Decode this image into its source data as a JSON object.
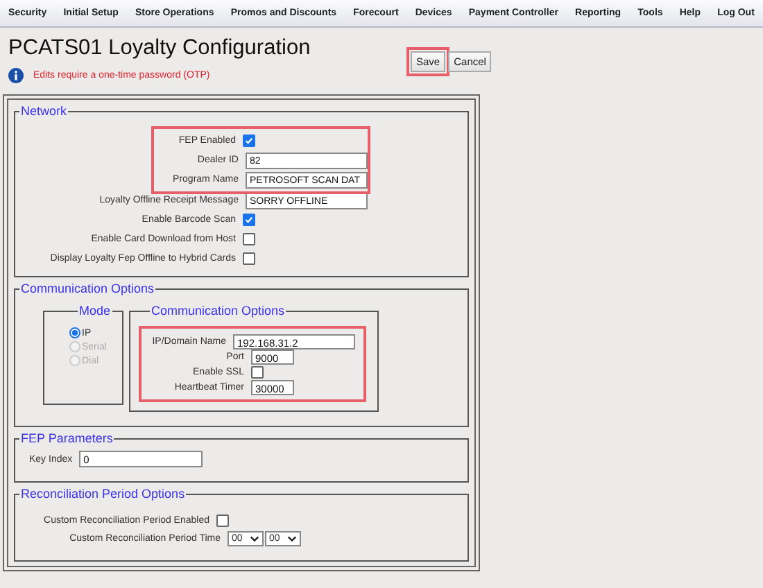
{
  "menu": [
    {
      "label": "Security"
    },
    {
      "label": "Initial Setup"
    },
    {
      "label": "Store Operations"
    },
    {
      "label": "Promos and Discounts"
    },
    {
      "label": "Forecourt"
    },
    {
      "label": "Devices"
    },
    {
      "label": "Payment Controller"
    },
    {
      "label": "Reporting"
    },
    {
      "label": "Tools"
    },
    {
      "label": "Help"
    },
    {
      "label": "Log Out"
    }
  ],
  "title": "PCATS01 Loyalty Configuration",
  "notice": "Edits require a one-time password (OTP)",
  "buttons": [
    {
      "label": "Save",
      "highlighted": true
    },
    {
      "label": "Cancel",
      "highlighted": false
    }
  ],
  "network": {
    "legend": "Network",
    "groups": [
      {
        "highlighted": true,
        "fields": [
          {
            "kind": "checkbox",
            "label": "FEP Enabled",
            "checked": true
          },
          {
            "kind": "text",
            "label": "Dealer ID",
            "value": "82"
          },
          {
            "kind": "text",
            "label": "Program Name",
            "value": "PETROSOFT SCAN DAT"
          }
        ]
      },
      {
        "highlighted": false,
        "fields": [
          {
            "kind": "text",
            "label": "Loyalty Offline Receipt Message",
            "value": "SORRY OFFLINE"
          },
          {
            "kind": "checkbox",
            "label": "Enable Barcode Scan",
            "checked": true
          },
          {
            "kind": "checkbox",
            "label": "Enable Card Download from Host",
            "checked": false
          },
          {
            "kind": "checkbox",
            "label": "Display Loyalty Fep Offline to Hybrid Cards",
            "checked": false
          }
        ]
      }
    ]
  },
  "communication": {
    "legend": "Communication Options",
    "mode": {
      "legend": "Mode",
      "options": [
        {
          "label": "IP",
          "selected": true,
          "disabled": false
        },
        {
          "label": "Serial",
          "selected": false,
          "disabled": true
        },
        {
          "label": "Dial",
          "selected": false,
          "disabled": true
        }
      ]
    },
    "options": {
      "legend": "Communication Options",
      "highlighted": true,
      "fields": [
        {
          "kind": "text",
          "label": "IP/Domain Name",
          "value": "192.168.31.2"
        },
        {
          "kind": "number",
          "label": "Port",
          "value": "9000"
        },
        {
          "kind": "checkbox",
          "label": "Enable SSL",
          "checked": false
        },
        {
          "kind": "number",
          "label": "Heartbeat Timer",
          "value": "30000"
        }
      ]
    }
  },
  "fep_parameters": {
    "legend": "FEP Parameters",
    "fields": [
      {
        "kind": "text",
        "label": "Key Index",
        "value": "0"
      }
    ]
  },
  "reconciliation": {
    "legend": "Reconciliation Period Options",
    "fields": [
      {
        "kind": "checkbox",
        "label": "Custom Reconciliation Period Enabled",
        "checked": false
      },
      {
        "kind": "select",
        "label": "Custom Reconciliation Period Time",
        "values": [
          "00",
          "00"
        ]
      }
    ]
  }
}
